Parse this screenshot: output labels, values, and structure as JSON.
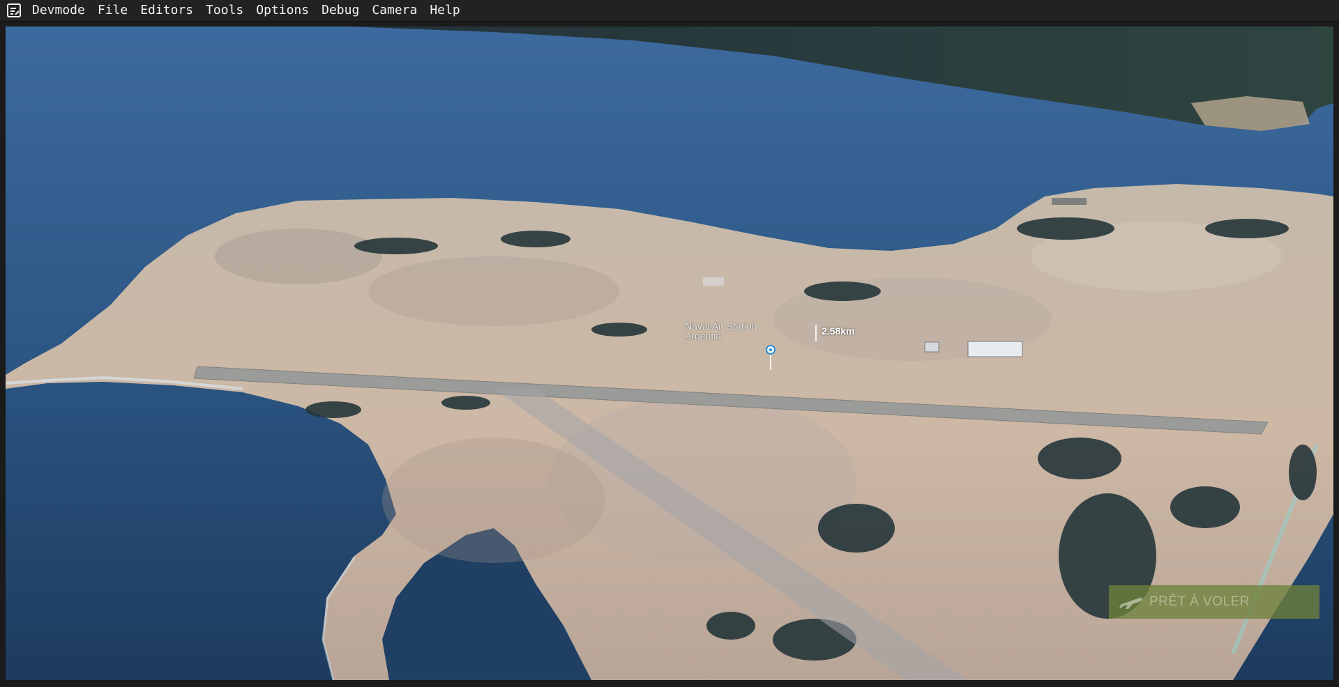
{
  "menubar": {
    "logo_icon": "devmode-logo-icon",
    "items": [
      {
        "label": "Devmode"
      },
      {
        "label": "File"
      },
      {
        "label": "Editors"
      },
      {
        "label": "Tools"
      },
      {
        "label": "Options"
      },
      {
        "label": "Debug"
      },
      {
        "label": "Camera"
      },
      {
        "label": "Help"
      }
    ]
  },
  "viewport": {
    "poi": {
      "name_line1": "Naval Air Station",
      "name_line2": "Argentia",
      "marker_icon": "airport-marker-icon"
    },
    "distance": "2.58km",
    "ready_button": {
      "label": "PRÊT À VOLER",
      "icon": "airplane-icon"
    }
  },
  "colors": {
    "menubar_bg": "#222222",
    "water": "#24466d",
    "land": "#c9b8a6",
    "ready_button": "#6e823c"
  }
}
